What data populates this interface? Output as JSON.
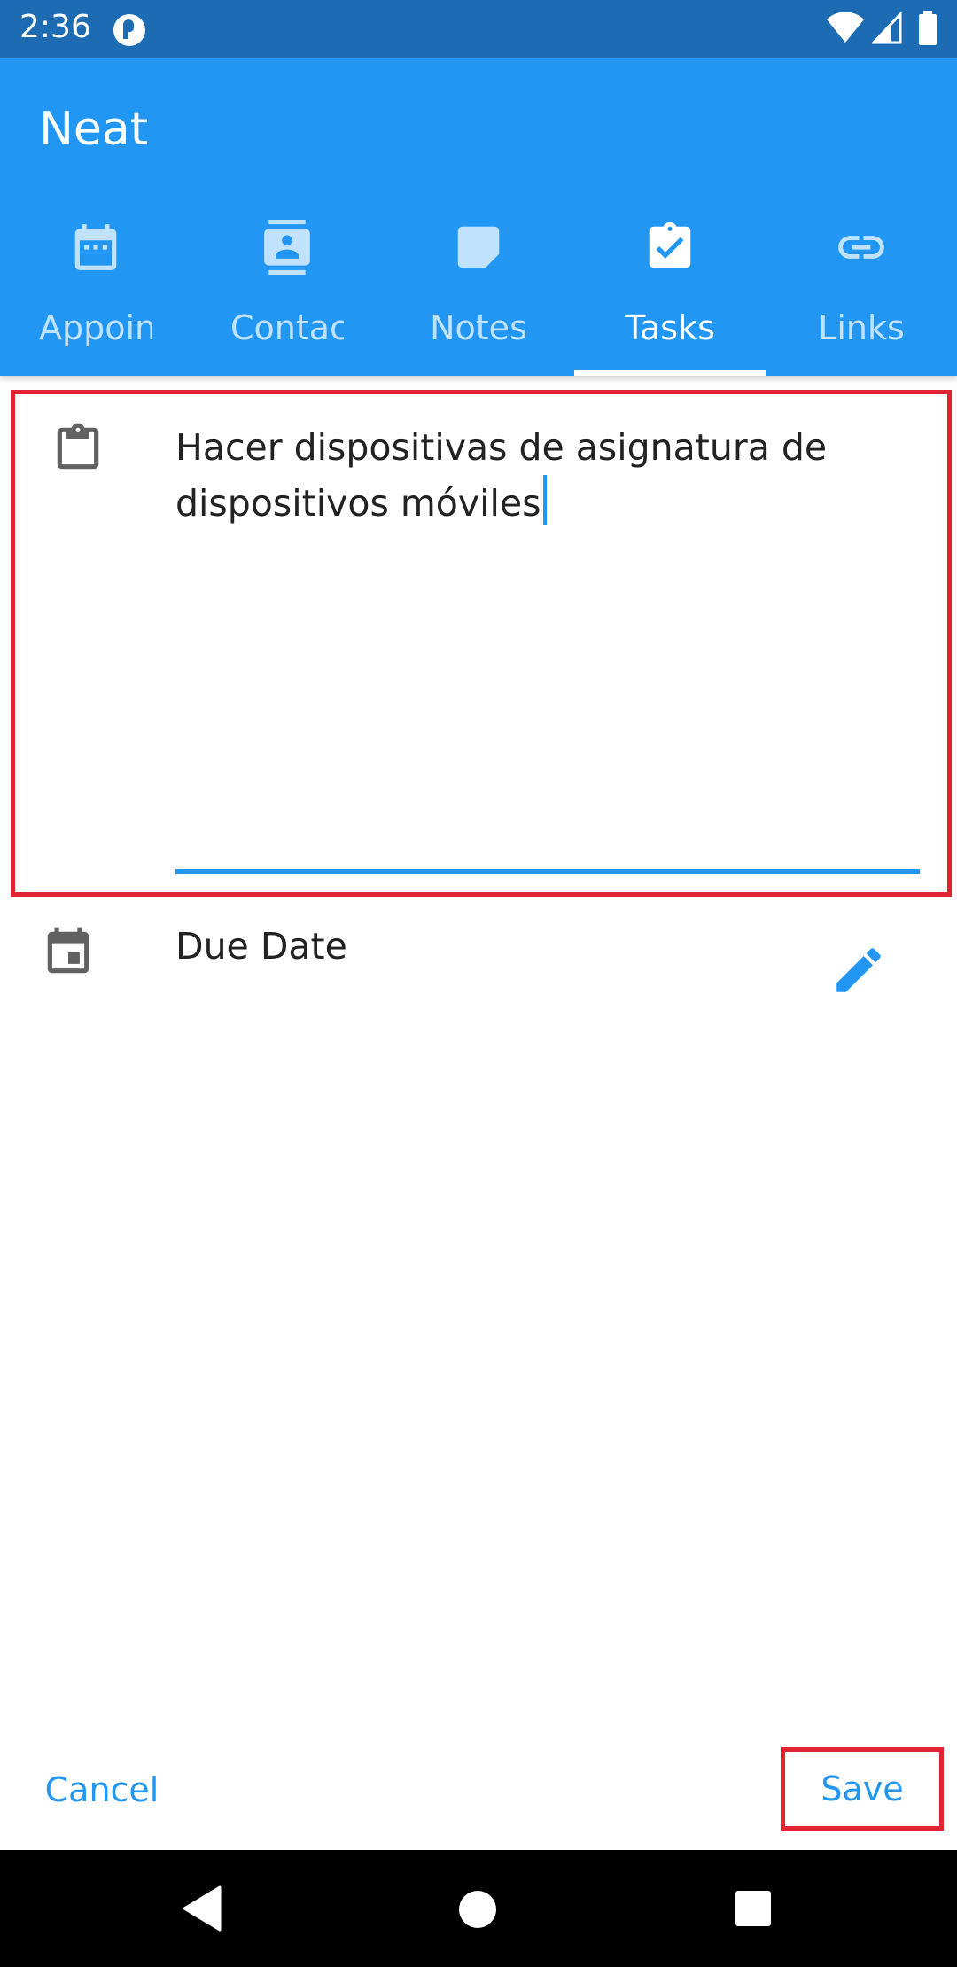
{
  "status_bar": {
    "time": "2:36",
    "icons": [
      "notification-icon",
      "wifi-icon",
      "signal-icon",
      "battery-icon"
    ]
  },
  "app": {
    "title": "Neat",
    "primary_color": "#2196f3",
    "status_bar_color": "#1c6bb3"
  },
  "tabs": [
    {
      "label": "Appoin",
      "icon": "calendar-icon",
      "active": false
    },
    {
      "label": "Contac",
      "icon": "contact-icon",
      "active": false
    },
    {
      "label": "Notes",
      "icon": "note-icon",
      "active": false
    },
    {
      "label": "Tasks",
      "icon": "task-check-icon",
      "active": true
    },
    {
      "label": "Links",
      "icon": "link-icon",
      "active": false
    }
  ],
  "task_form": {
    "description_value": "Hacer dispositivas de asignatura de dispositivos móviles",
    "due_date_label": "Due Date"
  },
  "actions": {
    "cancel_label": "Cancel",
    "save_label": "Save"
  },
  "highlight_color": "#e02431"
}
